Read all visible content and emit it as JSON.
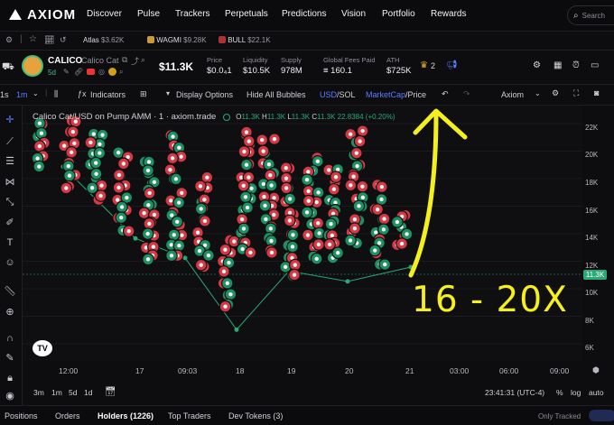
{
  "nav": {
    "logo": "AXIOM",
    "items": [
      "Discover",
      "Pulse",
      "Trackers",
      "Perpetuals",
      "Predictions",
      "Vision",
      "Portfolio",
      "Rewards"
    ],
    "search_placeholder": "Search"
  },
  "watchlist": [
    {
      "name": "Atlas",
      "value": "$3.62K"
    },
    {
      "name": "WAGMI",
      "value": "$9.28K"
    },
    {
      "name": "BULL",
      "value": "$22.1K"
    }
  ],
  "token": {
    "ticker": "CALICO",
    "name": "Calico Cat",
    "age": "5d",
    "price_mc": "$11.3K",
    "stats": [
      {
        "label": "Price",
        "value": "$0.0₄1"
      },
      {
        "label": "Liquidity",
        "value": "$10.5K"
      },
      {
        "label": "Supply",
        "value": "978M"
      },
      {
        "label": "Global Fees Paid",
        "value": "≡ 160.1"
      },
      {
        "label": "ATH",
        "value": "$725K"
      }
    ],
    "crown_count": "2"
  },
  "chart_toolbar": {
    "interval_1": "1s",
    "interval_2": "1m",
    "indicators": "Indicators",
    "display_options": "Display Options",
    "hide_bubbles": "Hide All Bubbles",
    "usd": "USD",
    "sol": "SOL",
    "marketcap": "MarketCap",
    "price": "Price",
    "layout": "Axiom"
  },
  "chart": {
    "symbol": "Calico Cat/USD on Pump AMM · 1 · axiom.trade",
    "ohlc": {
      "o": "11.3K",
      "h": "11.3K",
      "l": "11.3K",
      "c": "11.3K",
      "chg": "22.8384 (+0.20%)"
    },
    "last_price_tag": "11.3K",
    "annotation": "16 - 20X",
    "y_ticks": [
      "22K",
      "20K",
      "18K",
      "16K",
      "14K",
      "12K",
      "10K",
      "8K",
      "6K"
    ],
    "x_ticks": [
      "12:00",
      "17",
      "09:03",
      "18",
      "19",
      "20",
      "21",
      "03:00",
      "06:00",
      "09:00"
    ]
  },
  "chart_data": {
    "type": "line",
    "title": "Calico Cat/USD on Pump AMM · 1 · axiom.trade",
    "xlabel": "",
    "ylabel": "",
    "x": [
      "12:00",
      "17",
      "09:03",
      "18",
      "19",
      "20",
      "21"
    ],
    "values": [
      19000,
      13500,
      12000,
      6500,
      11000,
      10200,
      11300
    ],
    "ylim": [
      5000,
      23000
    ]
  },
  "bottom_toolbar": {
    "ranges": [
      "3m",
      "1m",
      "5d",
      "1d"
    ],
    "clock": "23:41:31 (UTC-4)",
    "pct": "%",
    "log": "log",
    "auto": "auto"
  },
  "bottom_tabs": [
    "Positions",
    "Orders",
    "Holders (1226)",
    "Top Traders",
    "Dev Tokens (3)"
  ],
  "bottom_right": "Only Tracked"
}
